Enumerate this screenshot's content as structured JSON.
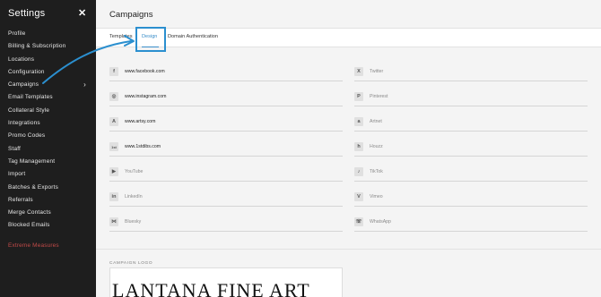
{
  "sidebar": {
    "title": "Settings",
    "close": "✕",
    "items": [
      {
        "label": "Profile"
      },
      {
        "label": "Billing & Subscription"
      },
      {
        "label": "Locations"
      },
      {
        "label": "Configuration"
      },
      {
        "label": "Campaigns",
        "chevron": "›"
      },
      {
        "label": "Email Templates"
      },
      {
        "label": "Collateral Style"
      },
      {
        "label": "Integrations"
      },
      {
        "label": "Promo Codes"
      },
      {
        "label": "Staff"
      },
      {
        "label": "Tag Management"
      },
      {
        "label": "Import"
      },
      {
        "label": "Batches & Exports"
      },
      {
        "label": "Referrals"
      },
      {
        "label": "Merge Contacts"
      },
      {
        "label": "Blocked Emails"
      }
    ],
    "danger_item": "Extreme Measures"
  },
  "main": {
    "title": "Campaigns",
    "tabs": [
      {
        "label": "Templates"
      },
      {
        "label": "Design"
      },
      {
        "label": "Domain Authentication"
      }
    ],
    "social_left": [
      {
        "icon": "facebook-icon",
        "glyph": "f",
        "value": "www.facebook.com"
      },
      {
        "icon": "instagram-icon",
        "glyph": "◎",
        "value": "www.instagram.com"
      },
      {
        "icon": "artsy-icon",
        "glyph": "A",
        "value": "www.artsy.com"
      },
      {
        "icon": "1stdibs-icon",
        "glyph": "1st",
        "value": "www.1stdibs.com"
      },
      {
        "icon": "youtube-icon",
        "glyph": "▶",
        "value": "YouTube",
        "placeholder": true
      },
      {
        "icon": "linkedin-icon",
        "glyph": "in",
        "value": "LinkedIn",
        "placeholder": true
      },
      {
        "icon": "bluesky-icon",
        "glyph": "⋈",
        "value": "Bluesky",
        "placeholder": true
      }
    ],
    "social_right": [
      {
        "icon": "x-icon",
        "glyph": "X",
        "value": "Twitter"
      },
      {
        "icon": "pinterest-icon",
        "glyph": "P",
        "value": "Pinterest"
      },
      {
        "icon": "artnet-icon",
        "glyph": "a",
        "value": "Artnet"
      },
      {
        "icon": "houzz-icon",
        "glyph": "h",
        "value": "Houzz"
      },
      {
        "icon": "tiktok-icon",
        "glyph": "♪",
        "value": "TikTok"
      },
      {
        "icon": "vimeo-icon",
        "glyph": "V",
        "value": "Vimeo"
      },
      {
        "icon": "whatsapp-icon",
        "glyph": "☏",
        "value": "WhatsApp"
      }
    ],
    "logo_label": "CAMPAIGN LOGO",
    "logo_text": "LANTANA FINE ART"
  },
  "colors": {
    "sidebar_bg": "#1e1e1e",
    "accent": "#2b8fcf",
    "danger": "#c24a48"
  }
}
